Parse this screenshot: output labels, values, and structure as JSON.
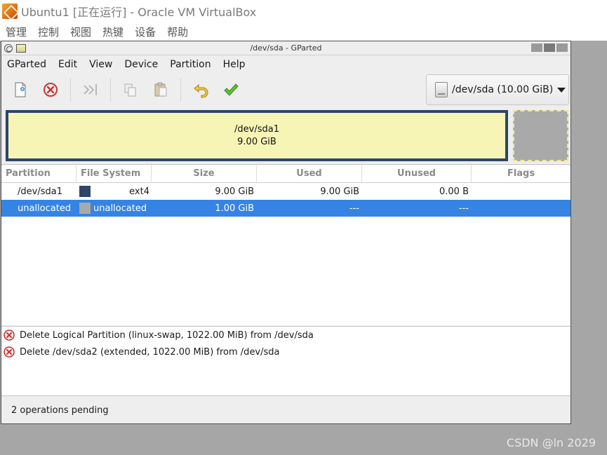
{
  "host": {
    "title": "Ubuntu1 [正在运行] - Oracle VM VirtualBox",
    "menu": [
      "管理",
      "控制",
      "视图",
      "热键",
      "设备",
      "帮助"
    ]
  },
  "window": {
    "title": "/dev/sda - GParted"
  },
  "menubar": [
    "GParted",
    "Edit",
    "View",
    "Device",
    "Partition",
    "Help"
  ],
  "toolbar": {
    "buttons": [
      "new-partition",
      "delete-partition",
      "resize-move",
      "copy",
      "paste",
      "undo",
      "apply"
    ],
    "device": "/dev/sda (10.00 GiB)"
  },
  "visual": {
    "partition_name": "/dev/sda1",
    "partition_size": "9.00 GiB"
  },
  "table": {
    "headers": [
      "Partition",
      "File System",
      "Size",
      "Used",
      "Unused",
      "Flags"
    ],
    "rows": [
      {
        "partition": "/dev/sda1",
        "filesystem": "ext4",
        "size": "9.00 GiB",
        "used": "9.00 GiB",
        "unused": "0.00 B",
        "flags": "",
        "color": "#2e4566",
        "selected": false
      },
      {
        "partition": "unallocated",
        "filesystem": "unallocated",
        "size": "1.00 GiB",
        "used": "---",
        "unused": "---",
        "flags": "",
        "color": "#a9a9a9",
        "selected": true
      }
    ]
  },
  "operations": [
    "Delete Logical Partition (linux-swap, 1022.00 MiB) from /dev/sda",
    "Delete /dev/sda2 (extended, 1022.00 MiB) from /dev/sda"
  ],
  "status": "2 operations pending",
  "watermark": "CSDN @ln 2029",
  "colors": {
    "selection": "#3584e4",
    "ext4": "#2e4566",
    "partition_fill": "#f7f5b6",
    "unallocated": "#a9a9a9"
  }
}
